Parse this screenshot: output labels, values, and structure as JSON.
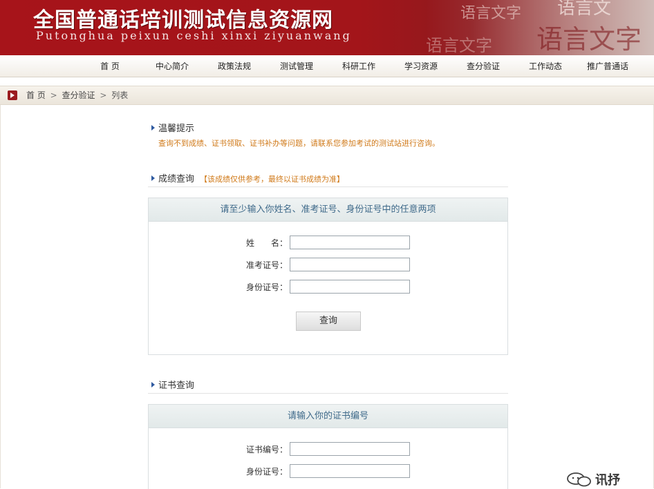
{
  "banner": {
    "title": "全国普通话培训测试信息资源网",
    "subtitle": "Putonghua peixun ceshi xinxi ziyuanwang",
    "decor_text": "语言文字"
  },
  "nav": {
    "items": [
      "首 页",
      "中心简介",
      "政策法规",
      "测试管理",
      "科研工作",
      "学习资源",
      "查分验证",
      "工作动态",
      "推广普通话"
    ]
  },
  "breadcrumb": {
    "home": "首 页",
    "sep": ">",
    "section": "查分验证",
    "current": "列表"
  },
  "tips": {
    "title": "温馨提示",
    "text": "查询不到成绩、证书领取、证书补办等问题，请联系您参加考试的测试站进行咨询。"
  },
  "score_query": {
    "title": "成绩查询",
    "note": "【该成绩仅供参考，最终以证书成绩为准】",
    "panel_title": "请至少输入你姓名、准考证号、身份证号中的任意两项",
    "fields": [
      {
        "label": "姓　　名：",
        "value": "",
        "placeholder": ""
      },
      {
        "label": "准考证号：",
        "value": "",
        "placeholder": ""
      },
      {
        "label": "身份证号：",
        "value": "",
        "placeholder": ""
      }
    ],
    "button_label": "查询"
  },
  "cert_query": {
    "title": "证书查询",
    "panel_title": "请输入你的证书编号",
    "fields": [
      {
        "label": "证书编号：",
        "value": "",
        "placeholder": ""
      },
      {
        "label": "身份证号：",
        "value": "",
        "placeholder": ""
      }
    ]
  },
  "watermark": {
    "text": "讯抒"
  },
  "colors": {
    "banner_red": "#a7141a",
    "tip_orange": "#d07a1a",
    "panel_head_text": "#3f6a8a",
    "arrow_blue": "#2f5aa0"
  }
}
